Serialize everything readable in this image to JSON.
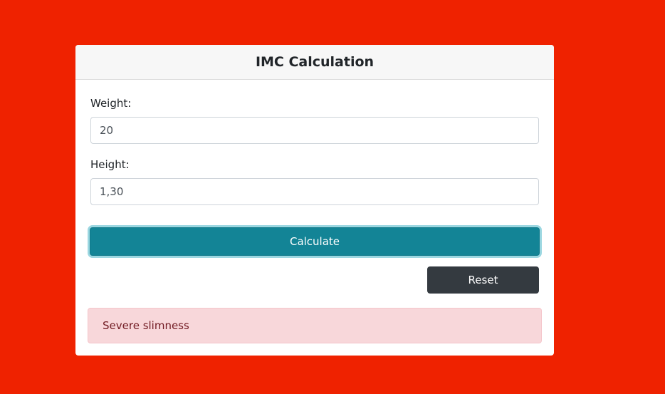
{
  "card": {
    "title": "IMC Calculation"
  },
  "form": {
    "weight_label": "Weight:",
    "weight_value": "20",
    "height_label": "Height:",
    "height_value": "1,30"
  },
  "buttons": {
    "calculate_label": "Calculate",
    "reset_label": "Reset"
  },
  "result": {
    "message": "Severe slimness"
  },
  "colors": {
    "background": "#ef2200",
    "calculate_button": "#138496",
    "reset_button": "#343a40",
    "alert_background": "#f8d7da",
    "alert_text": "#721c24"
  }
}
